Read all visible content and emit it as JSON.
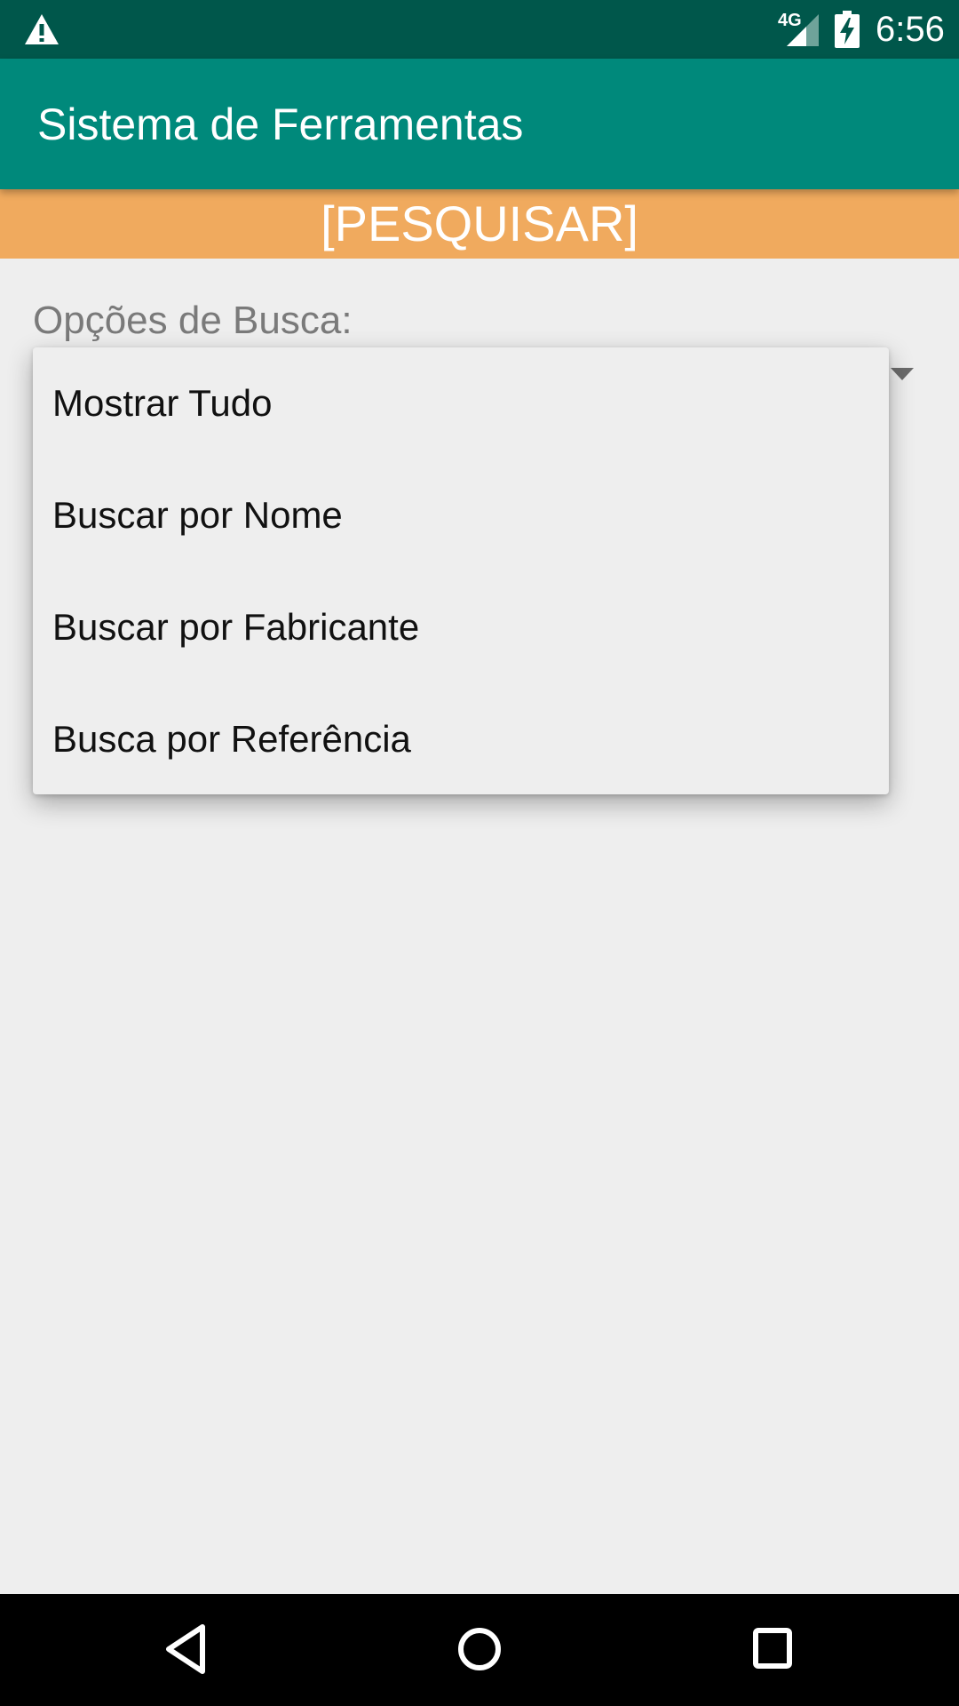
{
  "status_bar": {
    "time": "6:56",
    "network_label": "4G",
    "icons": [
      "warning-icon",
      "signal-icon",
      "battery-charging-icon"
    ],
    "background_color": "#00574b"
  },
  "app_bar": {
    "title": "Sistema de Ferramentas",
    "background_color": "#00897b"
  },
  "search_header": {
    "label": "[PESQUISAR]",
    "background_color": "#f0aa5e"
  },
  "search_options": {
    "label": "Opções de Busca:",
    "dropdown_icon": "dropdown-arrow-icon",
    "items": [
      {
        "label": "Mostrar Tudo"
      },
      {
        "label": "Buscar por Nome"
      },
      {
        "label": "Buscar por Fabricante"
      },
      {
        "label": "Busca por Referência"
      }
    ]
  },
  "nav_bar": {
    "icons": [
      "back-icon",
      "home-icon",
      "recents-icon"
    ]
  }
}
